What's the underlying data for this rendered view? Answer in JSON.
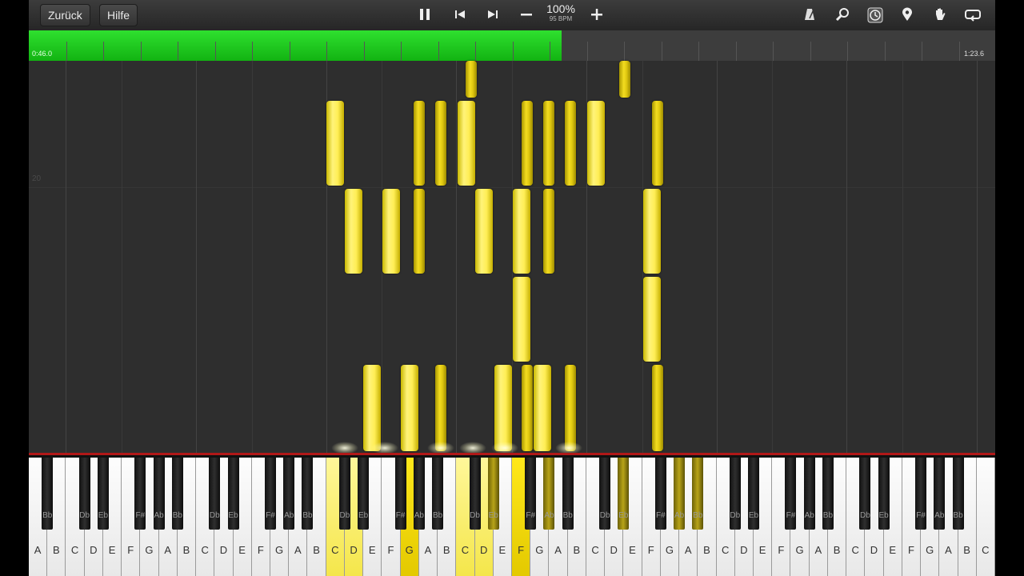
{
  "toolbar": {
    "back_label": "Zurück",
    "help_label": "Hilfe",
    "tempo_percent": "100%",
    "tempo_bpm": "95 BPM",
    "icons": [
      "pause-icon",
      "skip-back-icon",
      "skip-forward-icon",
      "minus-icon",
      "plus-icon",
      "metronome-icon",
      "search-icon",
      "wait-mode-icon",
      "location-pin-icon",
      "hand-icon",
      "loop-icon"
    ]
  },
  "progress": {
    "elapsed": "0:46.0",
    "total": "1:23.6",
    "fraction": 0.551
  },
  "roll": {
    "measure_number": "20"
  },
  "keyboard": {
    "white_keys": [
      "A",
      "B",
      "C",
      "D",
      "E",
      "F",
      "G",
      "A",
      "B",
      "C",
      "D",
      "E",
      "F",
      "G",
      "A",
      "B",
      "C",
      "D",
      "E",
      "F",
      "G",
      "A",
      "B",
      "C",
      "D",
      "E",
      "F",
      "G",
      "A",
      "B",
      "C",
      "D",
      "E",
      "F",
      "G",
      "A",
      "B",
      "C",
      "D",
      "E",
      "F",
      "G",
      "A",
      "B",
      "C",
      "D",
      "E",
      "F",
      "G",
      "A",
      "B",
      "C"
    ],
    "black_keys": [
      "Bb",
      "Db",
      "Eb",
      "F#",
      "Ab",
      "Bb",
      "Db",
      "Eb",
      "F#",
      "Ab",
      "Bb",
      "Db",
      "Eb",
      "F#",
      "Ab",
      "Bb",
      "Db",
      "Eb",
      "F#",
      "Ab",
      "Bb",
      "Db",
      "Eb",
      "F#",
      "Ab",
      "Bb",
      "Db",
      "Eb",
      "F#",
      "Ab",
      "Bb",
      "Db",
      "Eb",
      "F#",
      "Ab",
      "Bb"
    ],
    "colors": {
      "lit": "#f4e64a",
      "lit_strong": "#ffe81a",
      "note": "#ffee55",
      "progress": "#1ecb1e",
      "accent_line": "#b01818"
    }
  }
}
